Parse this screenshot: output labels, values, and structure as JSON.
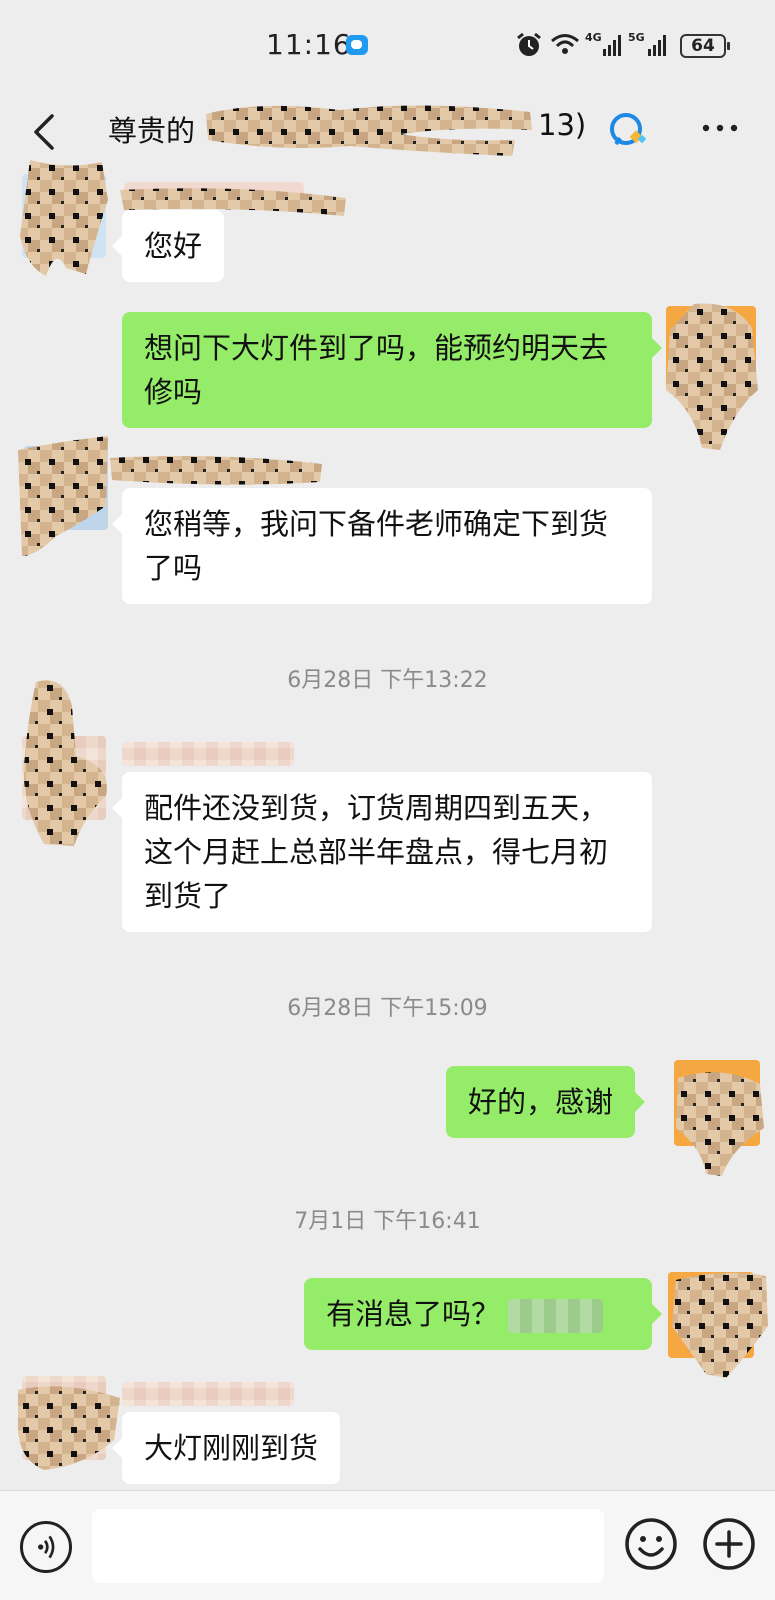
{
  "status_bar": {
    "time": "11:16",
    "network_4g": "4G",
    "network_5g": "5G",
    "battery": "64"
  },
  "header": {
    "title_prefix": "尊贵的",
    "title_count": "13)"
  },
  "messages": [
    {
      "side": "in",
      "text": "您好"
    },
    {
      "side": "out",
      "text": "想问下大灯件到了吗，能预约明天去修吗"
    },
    {
      "side": "in",
      "text": "您稍等，我问下备件老师确定下到货了吗"
    },
    {
      "side": "in",
      "text": "配件还没到货，订货周期四到五天，这个月赶上总部半年盘点，得七月初到货了"
    },
    {
      "side": "out",
      "text": "好的，感谢"
    },
    {
      "side": "out",
      "text": "有消息了吗？"
    },
    {
      "side": "in",
      "text": "大灯刚刚到货"
    }
  ],
  "timestamps": [
    "6月28日 下午13:22",
    "6月28日 下午15:09",
    "7月1日 下午16:41"
  ],
  "input": {
    "value": "",
    "placeholder": ""
  },
  "colors": {
    "background": "#ededed",
    "outgoing_bubble": "#95ec69",
    "incoming_bubble": "#ffffff",
    "timestamp": "#8a8a8a"
  },
  "icons": [
    "back-icon",
    "group-chat-icon",
    "more-icon",
    "voice-icon",
    "emoji-icon",
    "plus-icon"
  ]
}
